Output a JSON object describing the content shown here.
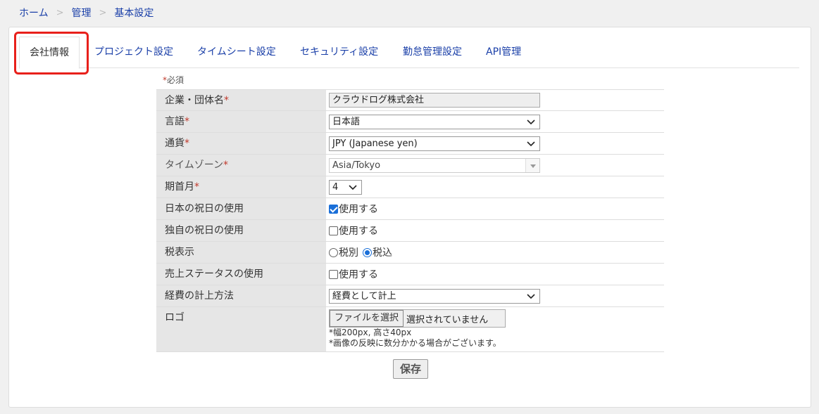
{
  "breadcrumb": {
    "home": "ホーム",
    "admin": "管理",
    "current": "基本設定",
    "sep": ">"
  },
  "tabs": [
    {
      "label": "会社情報"
    },
    {
      "label": "プロジェクト設定"
    },
    {
      "label": "タイムシート設定"
    },
    {
      "label": "セキュリティ設定"
    },
    {
      "label": "勤怠管理設定"
    },
    {
      "label": "API管理"
    }
  ],
  "required_note": {
    "star": "*",
    "text": "必須"
  },
  "form": {
    "company_name": {
      "label": "企業・団体名",
      "req": "*",
      "value": "クラウドログ株式会社"
    },
    "language": {
      "label": "言語",
      "req": "*",
      "value": "日本語"
    },
    "currency": {
      "label": "通貨",
      "req": "*",
      "value": "JPY (Japanese yen)"
    },
    "timezone": {
      "label": "タイムゾーン",
      "req": "*",
      "value": "Asia/Tokyo"
    },
    "fiscal_month": {
      "label": "期首月",
      "req": "*",
      "value": "4"
    },
    "jp_holidays": {
      "label": "日本の祝日の使用",
      "option": "使用する",
      "checked": true
    },
    "custom_holidays": {
      "label": "独自の祝日の使用",
      "option": "使用する",
      "checked": false
    },
    "tax_display": {
      "label": "税表示",
      "opt_excl": "税別",
      "opt_incl": "税込",
      "selected": "税込"
    },
    "sales_status": {
      "label": "売上ステータスの使用",
      "option": "使用する",
      "checked": false
    },
    "expense_method": {
      "label": "経費の計上方法",
      "value": "経費として計上"
    },
    "logo": {
      "label": "ロゴ",
      "button": "ファイルを選択",
      "status": "選択されていません",
      "hint1": "*幅200px, 高さ40px",
      "hint2": "*画像の反映に数分かかる場合がございます。"
    }
  },
  "save_label": "保存",
  "colors": {
    "link": "#1a3fa8",
    "required": "#c0392b",
    "highlight": "#e8201b",
    "checked": "#1a6fd8"
  }
}
